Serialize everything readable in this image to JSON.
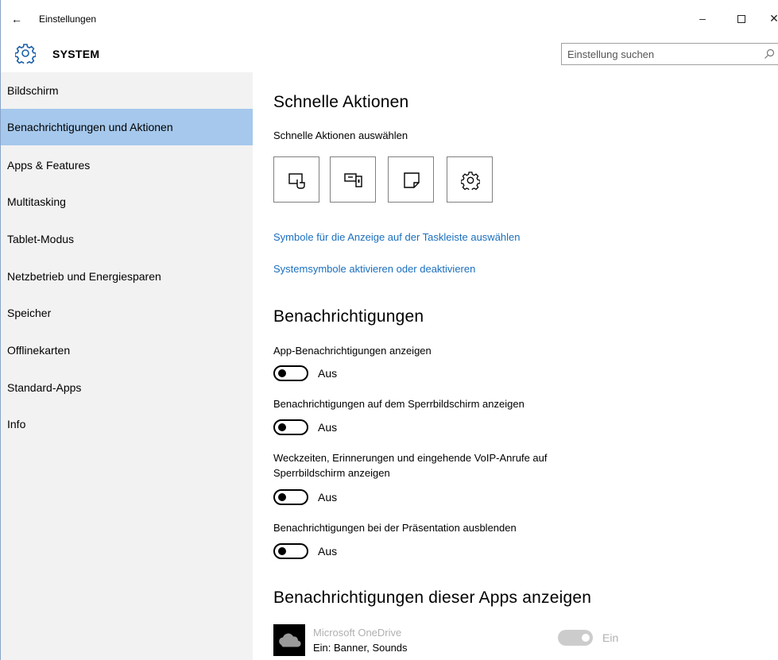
{
  "window": {
    "title": "Einstellungen",
    "back_glyph": "←",
    "min_glyph": "–",
    "close_glyph": "✕"
  },
  "header": {
    "category": "SYSTEM",
    "icon": "gear-icon",
    "search_placeholder": "Einstellung suchen"
  },
  "sidebar": {
    "items": [
      {
        "label": "Bildschirm",
        "active": false
      },
      {
        "label": "Benachrichtigungen und Aktionen",
        "active": true
      },
      {
        "label": "Apps & Features",
        "active": false
      },
      {
        "label": "Multitasking",
        "active": false
      },
      {
        "label": "Tablet-Modus",
        "active": false
      },
      {
        "label": "Netzbetrieb und Energiesparen",
        "active": false
      },
      {
        "label": "Speicher",
        "active": false
      },
      {
        "label": "Offlinekarten",
        "active": false
      },
      {
        "label": "Standard-Apps",
        "active": false
      },
      {
        "label": "Info",
        "active": false
      }
    ]
  },
  "quick_actions": {
    "heading": "Schnelle Aktionen",
    "subheading": "Schnelle Aktionen auswählen",
    "tiles": [
      {
        "icon": "tablet-mode-icon"
      },
      {
        "icon": "project-icon"
      },
      {
        "icon": "note-icon"
      },
      {
        "icon": "settings-icon"
      }
    ],
    "link_taskbar": "Symbole für die Anzeige auf der Taskleiste auswählen",
    "link_system_icons": "Systemsymbole aktivieren oder deaktivieren"
  },
  "notifications": {
    "heading": "Benachrichtigungen",
    "settings": [
      {
        "label": "App-Benachrichtigungen anzeigen",
        "state": "Aus"
      },
      {
        "label": "Benachrichtigungen auf dem Sperrbildschirm anzeigen",
        "state": "Aus"
      },
      {
        "label_line1": "Weckzeiten, Erinnerungen und eingehende VoIP-Anrufe auf",
        "label_line2": "Sperrbildschirm anzeigen",
        "state": "Aus"
      },
      {
        "label": "Benachrichtigungen bei der Präsentation ausblenden",
        "state": "Aus"
      }
    ]
  },
  "apps_section": {
    "heading": "Benachrichtigungen dieser Apps anzeigen",
    "apps": [
      {
        "name": "Microsoft OneDrive",
        "detail": "Ein: Banner, Sounds",
        "state": "Ein",
        "icon": "onedrive-icon"
      }
    ]
  },
  "colors": {
    "accent": "#1a6fbf",
    "sidebar_bg": "#f2f2f2",
    "sidebar_active": "#a5c8ec"
  }
}
